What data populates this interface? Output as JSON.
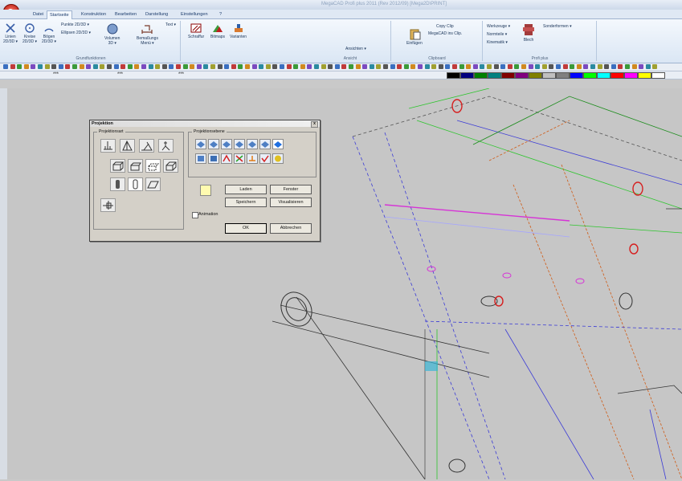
{
  "window": {
    "title": "MegaCAD Profi plus 2011 (Rev 2012/09) [Mega2D\\PRINT]"
  },
  "tabs": [
    "Datei",
    "Startseite",
    "Konstruktion",
    "Bearbeiten",
    "Darstellung",
    "Einstellungen",
    "?"
  ],
  "ribbon": {
    "linien": "Linien\n2D/3D ▾",
    "kreise": "Kreise\n2D/3D ▾",
    "boegen": "Bögen\n2D/3D ▾",
    "punkte": "Punkte 2D/3D ▾",
    "ellipsen": "Ellipsen 2D/3D ▾",
    "volumen": "Volumen\n3D ▾",
    "bemassung": "Bemaßungs\nMenü ▾",
    "text": "Text ▾",
    "schraffur": "Schraffur",
    "bitmaps": "Bitmaps",
    "varianten": "Varianten",
    "grundfunktionen": "Grundfunktionen",
    "ansichten": "Ansichten ▾",
    "ansicht": "Ansicht",
    "einfuegen": "Einfügen",
    "copy_clip": "Copy Clip",
    "megacad_clip": "MegaCAD ins Clip.",
    "clipboard": "Clipboard",
    "werkzeuge": "Werkzeuge ▾",
    "normteile": "Normteile ▾",
    "kinematik": "Kinematik ▾",
    "blech": "Blech",
    "sonderformen": "Sonderformen ▾",
    "profi_plus": "Profi plus"
  },
  "toolbar2": {
    "field1": "***",
    "field2": "***",
    "field3": "***"
  },
  "palette": [
    "#000000",
    "#00007f",
    "#008000",
    "#008080",
    "#800000",
    "#800080",
    "#808000",
    "#c0c0c0",
    "#808080",
    "#0000ff",
    "#00ff00",
    "#00ffff",
    "#ff0000",
    "#ff00ff",
    "#ffff00",
    "#ffffff"
  ],
  "dialog": {
    "title": "Projektion",
    "close": "x",
    "projektionsart": "Projektionsart",
    "projektionsebene": "Projektionsebene",
    "laden": "Laden",
    "fenster": "Fenster",
    "speichern": "Speichern",
    "visualisieren": "Visualisieren",
    "animation": "Animation",
    "ok": "OK",
    "abbrechen": "Abbrechen"
  }
}
